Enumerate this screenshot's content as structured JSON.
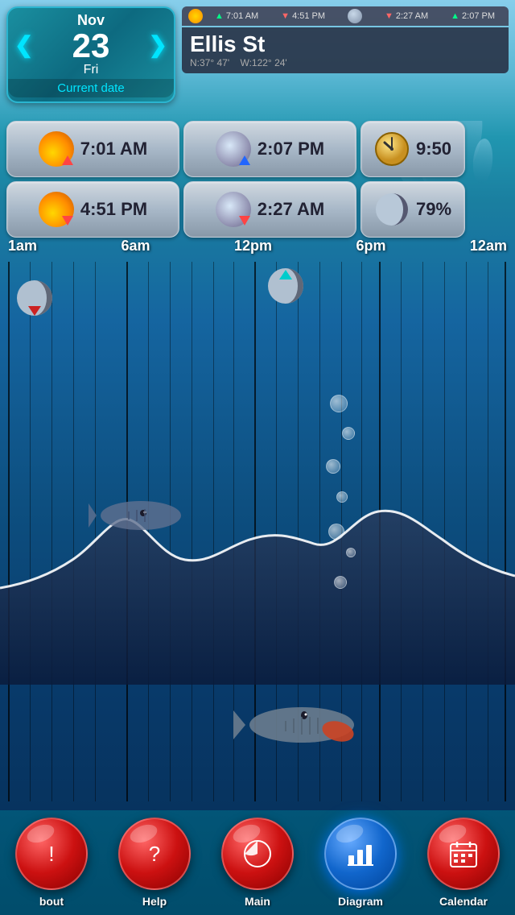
{
  "date": {
    "month": "Nov",
    "day": "23",
    "weekday": "Fri",
    "label": "Current date"
  },
  "status": {
    "times": [
      {
        "arrow": "▲",
        "time": "7:01 AM"
      },
      {
        "arrow": "▼",
        "time": "4:51 PM"
      },
      {
        "arrow": "▼",
        "time": "2:27 AM"
      },
      {
        "arrow": "▲",
        "time": "2:07 PM"
      }
    ]
  },
  "location": {
    "name": "Ellis St",
    "lat": "N:37° 47'",
    "lon": "W:122° 24'"
  },
  "info_cells": [
    {
      "label": "7:01 AM",
      "type": "sunrise"
    },
    {
      "label": "2:07 PM",
      "type": "moon-rise"
    },
    {
      "label": "9:50",
      "type": "clock"
    },
    {
      "label": "4:51 PM",
      "type": "sunset"
    },
    {
      "label": "2:27 AM",
      "type": "moon-set"
    },
    {
      "label": "79%",
      "type": "moon-phase"
    }
  ],
  "timeline": {
    "labels": [
      "1am",
      "6am",
      "12pm",
      "6pm",
      "12am"
    ]
  },
  "nav": {
    "items": [
      {
        "label": "bout",
        "icon": "!",
        "type": "red"
      },
      {
        "label": "Help",
        "icon": "?",
        "type": "red"
      },
      {
        "label": "Main",
        "icon": "◐",
        "type": "red"
      },
      {
        "label": "Diagram",
        "icon": "📊",
        "type": "blue"
      },
      {
        "label": "Calendar",
        "icon": "📅",
        "type": "red"
      }
    ]
  }
}
